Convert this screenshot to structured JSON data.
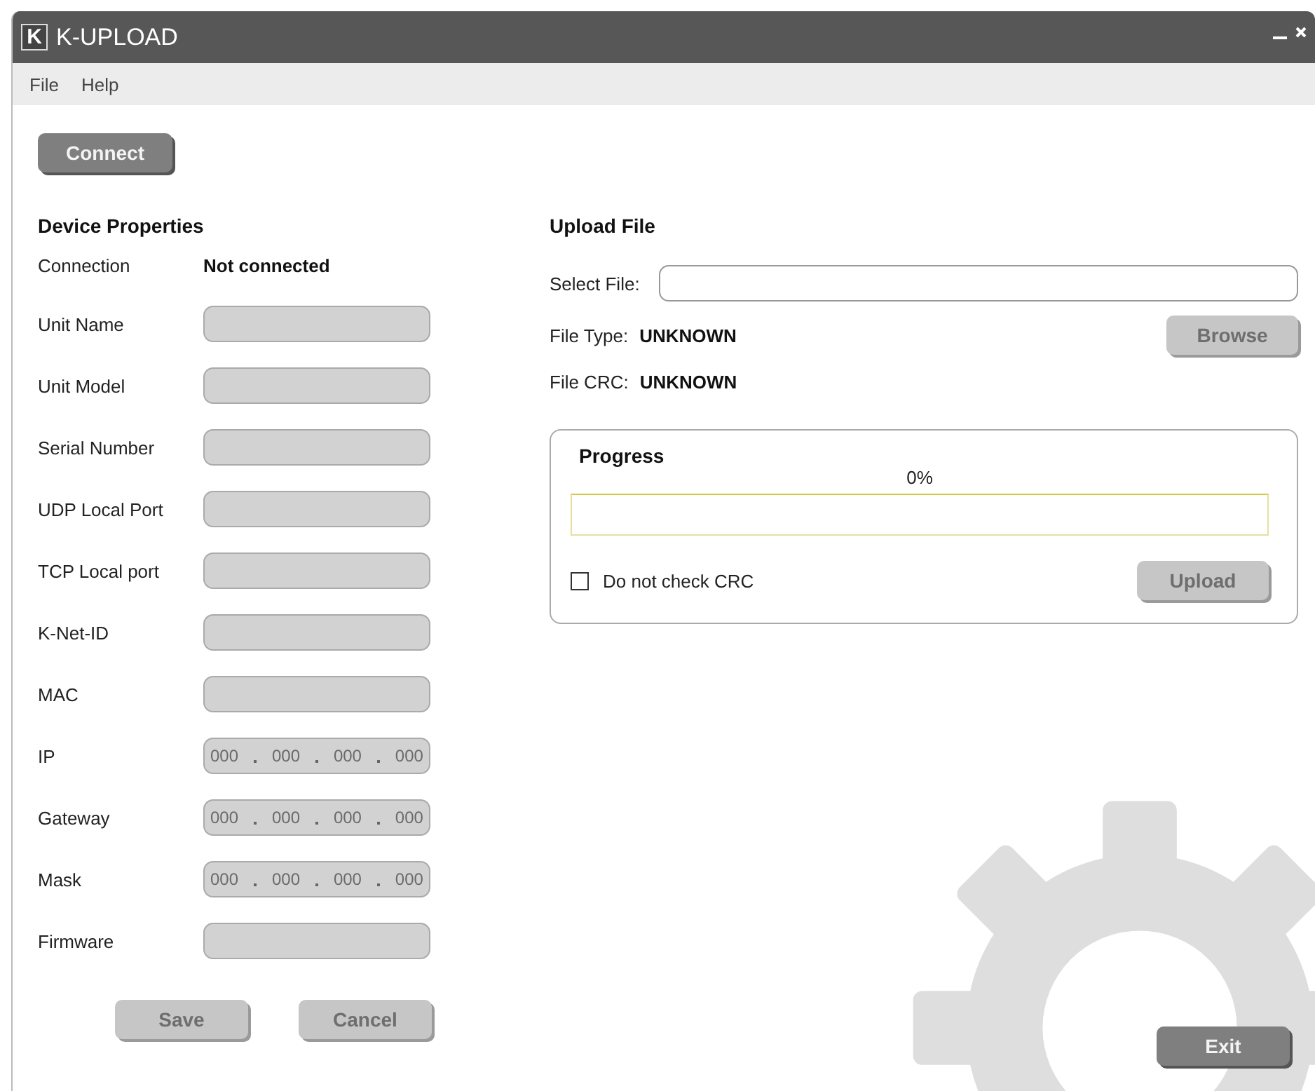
{
  "window": {
    "title": "K-UPLOAD",
    "logo": "K"
  },
  "menu": [
    "File",
    "Help"
  ],
  "connect_button": {
    "label": "Connect",
    "disabled": false
  },
  "device_properties": {
    "title": "Device Properties",
    "connection_label": "Connection",
    "connection_value": "Not connected",
    "fields": [
      {
        "label": "Unit Name",
        "kind": "text",
        "disabled": true
      },
      {
        "label": "Unit Model",
        "kind": "text",
        "disabled": true
      },
      {
        "label": "Serial Number",
        "kind": "text",
        "disabled": true
      },
      {
        "label": "UDP Local Port",
        "kind": "text",
        "disabled": true
      },
      {
        "label": "TCP Local port",
        "kind": "text",
        "disabled": true
      },
      {
        "label": "K-Net-ID",
        "kind": "text",
        "disabled": true
      },
      {
        "label": "MAC",
        "kind": "text",
        "disabled": true
      },
      {
        "label": "IP",
        "kind": "ip",
        "octets": [
          "000",
          "000",
          "000",
          "000"
        ],
        "disabled": true
      },
      {
        "label": "Gateway",
        "kind": "ip",
        "octets": [
          "000",
          "000",
          "000",
          "000"
        ],
        "disabled": true
      },
      {
        "label": "Mask",
        "kind": "ip",
        "octets": [
          "000",
          "000",
          "000",
          "000"
        ],
        "disabled": true
      },
      {
        "label": "Firmware",
        "kind": "text",
        "disabled": true
      }
    ],
    "buttons": [
      {
        "label": "Save",
        "disabled": true
      },
      {
        "label": "Cancel",
        "disabled": true
      }
    ]
  },
  "upload_file": {
    "title": "Upload File",
    "select_label": "Select File:",
    "file_type_label": "File Type:",
    "file_type_value": "UNKNOWN",
    "file_crc_label": "File CRC:",
    "file_crc_value": "UNKNOWN",
    "browse_button": {
      "label": "Browse",
      "disabled": true
    },
    "progress": {
      "title": "Progress",
      "reading": "0%",
      "level": 0,
      "checkbox": {
        "label": "Do not check CRC",
        "checked": false
      },
      "upload_button": {
        "label": "Upload",
        "disabled": true
      }
    }
  },
  "exit_button": {
    "label": "Exit",
    "disabled": false
  }
}
